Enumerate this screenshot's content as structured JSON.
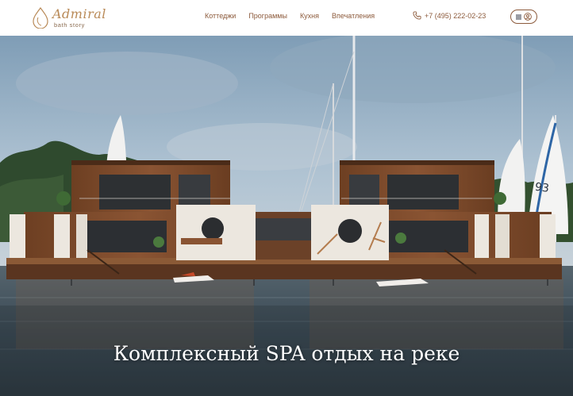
{
  "header": {
    "logo": {
      "name": "Admiral",
      "subtitle": "bath story"
    },
    "nav": [
      {
        "label": "Коттеджи"
      },
      {
        "label": "Программы"
      },
      {
        "label": "Кухня"
      },
      {
        "label": "Впечатления"
      }
    ],
    "phone": "+7 (495) 222-02-23",
    "icons": {
      "phone": "phone-icon",
      "menu": "menu-icon",
      "user": "user-icon"
    }
  },
  "hero": {
    "title": "Комплексный SPA отдых на реке",
    "colors": {
      "sky": "#8aa7bf",
      "water": "#3b4a55",
      "wood": "#7a4a2a",
      "white": "#ece7df"
    }
  }
}
